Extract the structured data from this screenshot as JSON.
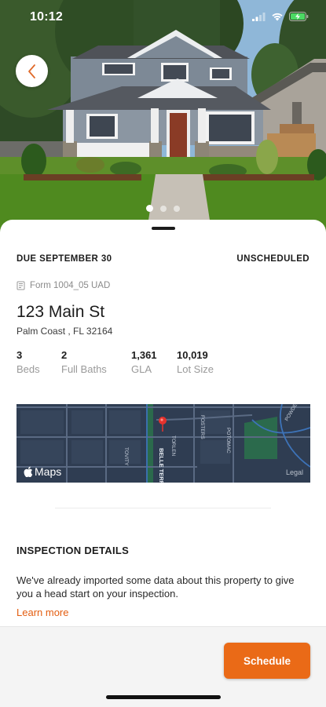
{
  "status_bar": {
    "time": "10:12"
  },
  "hero": {
    "page_count": 3,
    "active_page": 1
  },
  "card": {
    "due": "DUE SEPTEMBER 30",
    "state": "UNSCHEDULED",
    "form": "Form 1004_05 UAD",
    "address": "123 Main St",
    "city_line": "Palm Coast , FL 32164",
    "stats": [
      {
        "value": "3",
        "label": "Beds"
      },
      {
        "value": "2",
        "label": "Full Baths"
      },
      {
        "value": "1,361",
        "label": "GLA"
      },
      {
        "value": "10,019",
        "label": "Lot Size"
      }
    ]
  },
  "map": {
    "brand": "Maps",
    "legal": "Legal",
    "streets": [
      "BELLE TERRE",
      "TORLEN",
      "FOSTERS",
      "POTOMAC",
      "POWDER",
      "FOSTERL",
      "POTOMAC"
    ]
  },
  "inspection": {
    "title": "INSPECTION DETAILS",
    "body": "We've already imported some data about this property to give you a head start on your inspection.",
    "link": "Learn more"
  },
  "footer": {
    "schedule_label": "Schedule"
  },
  "colors": {
    "accent": "#ea6a17",
    "link": "#e35d10",
    "map_bg": "#2f3d52",
    "pin": "#e5322d"
  }
}
